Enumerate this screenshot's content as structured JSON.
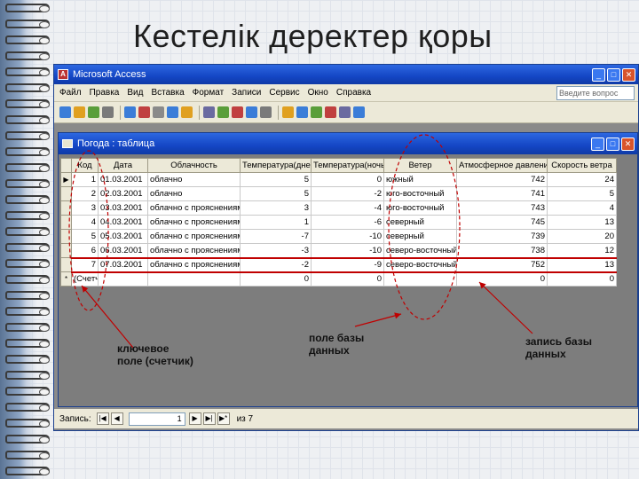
{
  "slide": {
    "title": "Кестелік деректер қоры"
  },
  "app": {
    "title": "Microsoft Access",
    "menu": [
      "Файл",
      "Правка",
      "Вид",
      "Вставка",
      "Формат",
      "Записи",
      "Сервис",
      "Окно",
      "Справка"
    ],
    "question_placeholder": "Введите вопрос"
  },
  "table_window": {
    "title": "Погода : таблица",
    "columns": [
      "Код",
      "Дата",
      "Облачность",
      "Температура(днем)",
      "Температура(ночью)",
      "Ветер",
      "Атмосферное давление",
      "Скорость ветра"
    ],
    "rows": [
      [
        "1",
        "01.03.2001",
        "облачно",
        "5",
        "0",
        "южный",
        "742",
        "24"
      ],
      [
        "2",
        "02.03.2001",
        "облачно",
        "5",
        "-2",
        "юго-восточный",
        "741",
        "5"
      ],
      [
        "3",
        "03.03.2001",
        "облачно с прояснениями",
        "3",
        "-4",
        "юго-восточный",
        "743",
        "4"
      ],
      [
        "4",
        "04.03.2001",
        "облачно с прояснениями",
        "1",
        "-6",
        "северный",
        "745",
        "13"
      ],
      [
        "5",
        "05.03.2001",
        "облачно с прояснениями",
        "-7",
        "-10",
        "северный",
        "739",
        "20"
      ],
      [
        "6",
        "06.03.2001",
        "облачно с прояснениями",
        "-3",
        "-10",
        "северо-восточный",
        "738",
        "12"
      ],
      [
        "7",
        "07.03.2001",
        "облачно с прояснениями",
        "-2",
        "-9",
        "северо-восточный",
        "752",
        "13"
      ]
    ],
    "new_row": [
      "(Счетчик)",
      "",
      "",
      "0",
      "0",
      "",
      "0",
      "0"
    ],
    "status": {
      "label": "Запись:",
      "current": "1",
      "of_label": "из 7"
    }
  },
  "annotations": {
    "key_field": "ключевое поле (счетчик)",
    "db_field": "поле базы данных",
    "db_record": "запись базы данных"
  },
  "colors": {
    "accent_red": "#c00000",
    "titlebar_blue": "#1446c5"
  }
}
